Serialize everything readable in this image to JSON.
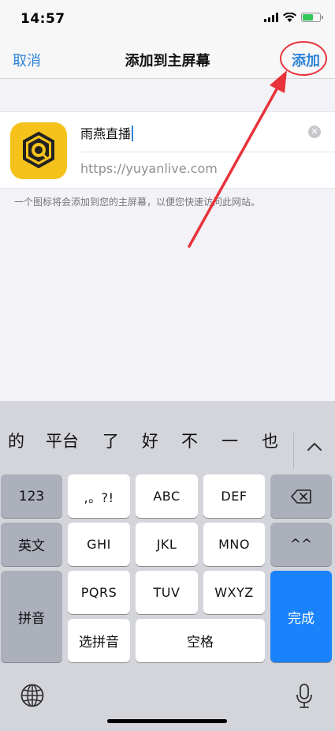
{
  "status": {
    "time": "14:57"
  },
  "nav": {
    "cancel": "取消",
    "title": "添加到主屏幕",
    "add": "添加"
  },
  "card": {
    "app_name": "雨燕直播",
    "url": "https://yuyanlive.com"
  },
  "hint": "一个图标将会添加到您的主屏幕，以便您快速访问此网站。",
  "keyboard": {
    "candidates": [
      "的",
      "平台",
      "了",
      "好",
      "不",
      "一",
      "也"
    ],
    "row1": {
      "num": "123",
      "punct": ",。?!",
      "abc": "ABC",
      "def": "DEF"
    },
    "row2": {
      "lang": "英文",
      "ghi": "GHI",
      "jkl": "JKL",
      "mno": "MNO",
      "emoji": "^^"
    },
    "row3": {
      "pinyin": "拼音",
      "pqrs": "PQRS",
      "tuv": "TUV",
      "wxyz": "WXYZ",
      "done": "完成"
    },
    "row4": {
      "select_pinyin": "选拼音",
      "space": "空格"
    }
  },
  "colors": {
    "accent": "#2f84d6",
    "highlight": "#e8333b",
    "done_key": "#1a82fb",
    "app_icon_bg": "#f5c21b"
  }
}
